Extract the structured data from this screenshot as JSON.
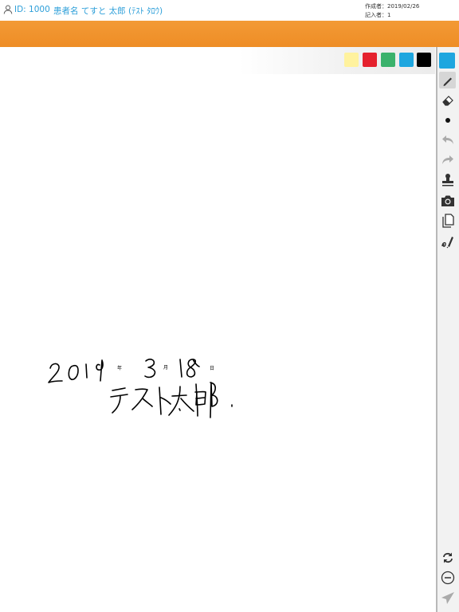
{
  "header": {
    "id_label": "ID: 1000",
    "patient_label": "患者名 てすと 太郎 (ﾃｽﾄ ﾀﾛｳ)",
    "created_label": "作成者：2019/02/26",
    "writer_label": "記入者：1"
  },
  "palette": {
    "colors": [
      "#fff29e",
      "#e5212d",
      "#3bb26c",
      "#1ea6df",
      "#000000"
    ],
    "current_color": "#1ea6df"
  },
  "tools": [
    "pen-icon",
    "eraser-icon",
    "dot-size-icon",
    "undo-icon",
    "redo-icon",
    "stamp-icon",
    "camera-icon",
    "copy-page-icon",
    "signature-icon"
  ],
  "bottom_tools": [
    "refresh-icon",
    "remove-icon",
    "send-icon"
  ],
  "handwriting": {
    "year": "2019",
    "year_unit": "年",
    "month": "3",
    "month_unit": "月",
    "day": "18",
    "day_unit": "日",
    "name": "テスト 太郎."
  }
}
